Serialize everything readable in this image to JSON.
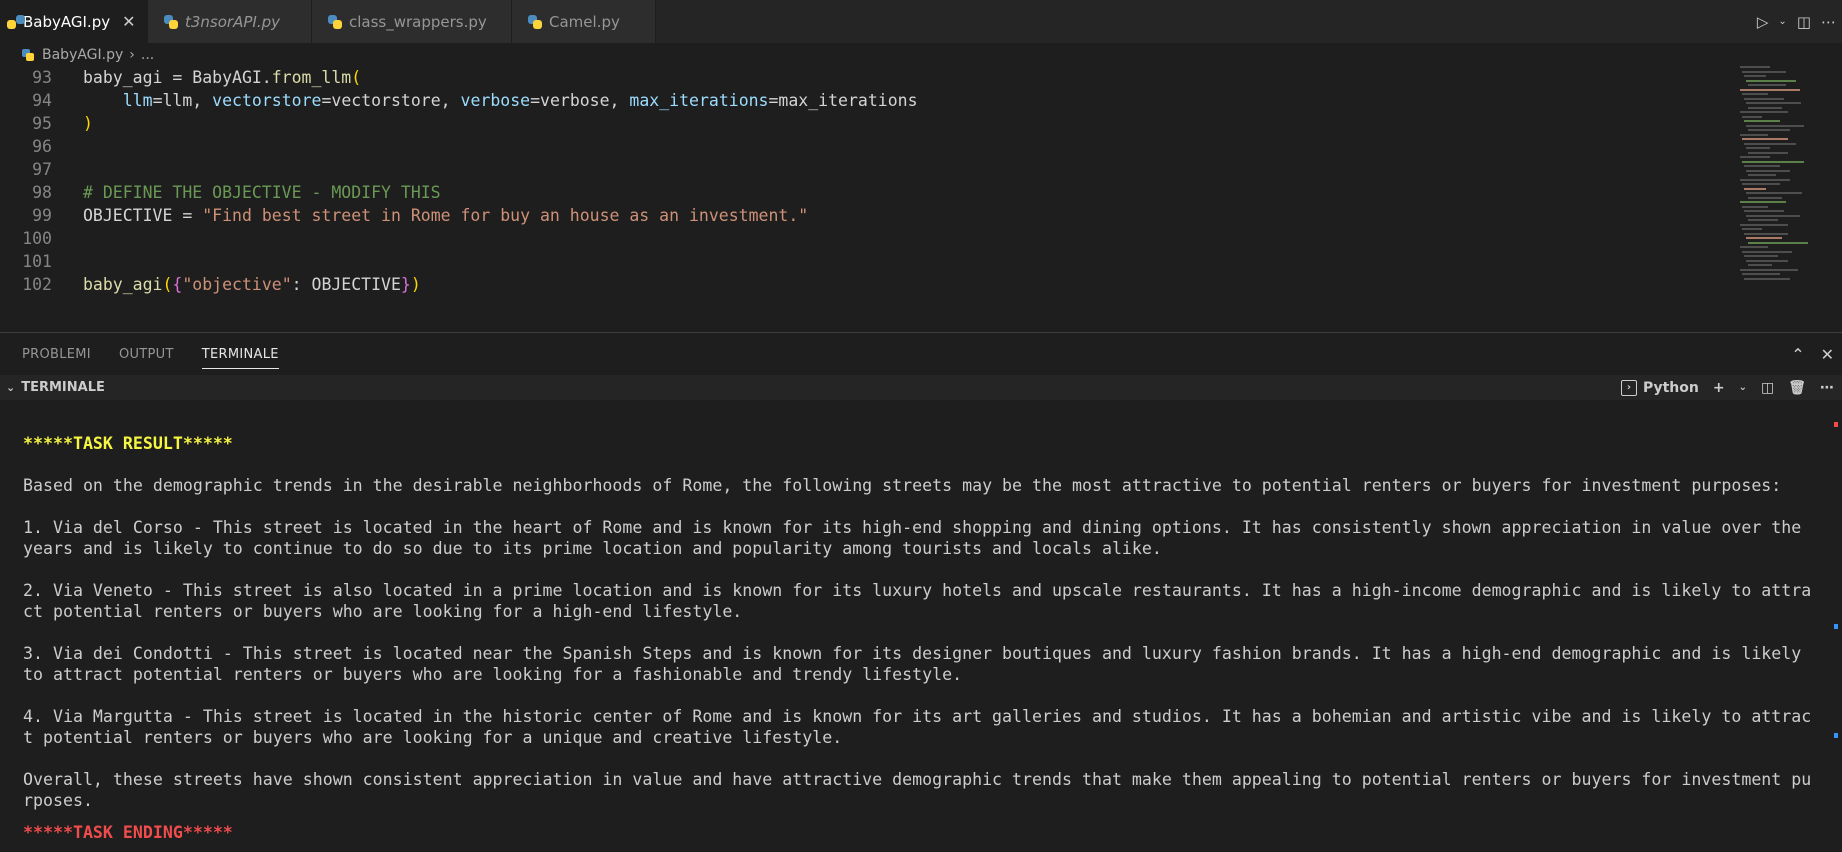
{
  "tabs": [
    {
      "label": "BabyAGI.py",
      "active": true,
      "closable": true,
      "italic": false
    },
    {
      "label": "t3nsorAPI.py",
      "active": false,
      "closable": false,
      "italic": true
    },
    {
      "label": "class_wrappers.py",
      "active": false,
      "closable": false,
      "italic": false
    },
    {
      "label": "Camel.py",
      "active": false,
      "closable": false,
      "italic": false
    }
  ],
  "breadcrumb": {
    "file": "BabyAGI.py",
    "rest": "..."
  },
  "editor": {
    "lines": [
      {
        "num": "93",
        "code": "baby_agi = BabyAGI.from_llm("
      },
      {
        "num": "94",
        "code": "    llm=llm, vectorstore=vectorstore, verbose=verbose, max_iterations=max_iterations"
      },
      {
        "num": "95",
        "code": ")"
      },
      {
        "num": "96",
        "code": ""
      },
      {
        "num": "97",
        "code": ""
      },
      {
        "num": "98",
        "code": "# DEFINE THE OBJECTIVE - MODIFY THIS"
      },
      {
        "num": "99",
        "code": "OBJECTIVE = \"Find best street in Rome for buy an house as an investment.\""
      },
      {
        "num": "100",
        "code": ""
      },
      {
        "num": "101",
        "code": ""
      },
      {
        "num": "102",
        "code": "baby_agi({\"objective\": OBJECTIVE})"
      }
    ]
  },
  "panel": {
    "tabs": [
      "PROBLEMI",
      "OUTPUT",
      "TERMINALE"
    ],
    "active_tab": "TERMINALE",
    "terminal_title": "TERMINALE",
    "shell": "Python"
  },
  "terminal": {
    "task_result_header": "*****TASK RESULT*****",
    "lines": [
      "Based on the demographic trends in the desirable neighborhoods of Rome, the following streets may be the most attractive to potential renters or buyers for investment purposes:",
      "",
      "1. Via del Corso - This street is located in the heart of Rome and is known for its high-end shopping and dining options. It has consistently shown appreciation in value over the",
      "years and is likely to continue to do so due to its prime location and popularity among tourists and locals alike.",
      "",
      "2. Via Veneto - This street is also located in a prime location and is known for its luxury hotels and upscale restaurants. It has a high-income demographic and is likely to attra",
      "ct potential renters or buyers who are looking for a high-end lifestyle.",
      "",
      "3. Via dei Condotti - This street is located near the Spanish Steps and is known for its designer boutiques and luxury fashion brands. It has a high-end demographic and is likely",
      "to attract potential renters or buyers who are looking for a fashionable and trendy lifestyle.",
      "",
      "4. Via Margutta - This street is located in the historic center of Rome and is known for its art galleries and studios. It has a bohemian and artistic vibe and is likely to attrac",
      "t potential renters or buyers who are looking for a unique and creative lifestyle.",
      "",
      "Overall, these streets have shown consistent appreciation in value and have attractive demographic trends that make them appealing to potential renters or buyers for investment pu",
      "rposes."
    ],
    "task_ending_header": "*****TASK ENDING*****"
  },
  "colors": {
    "yellow": "#f5f543",
    "red": "#f14c4c",
    "accent": "#3794ff"
  }
}
